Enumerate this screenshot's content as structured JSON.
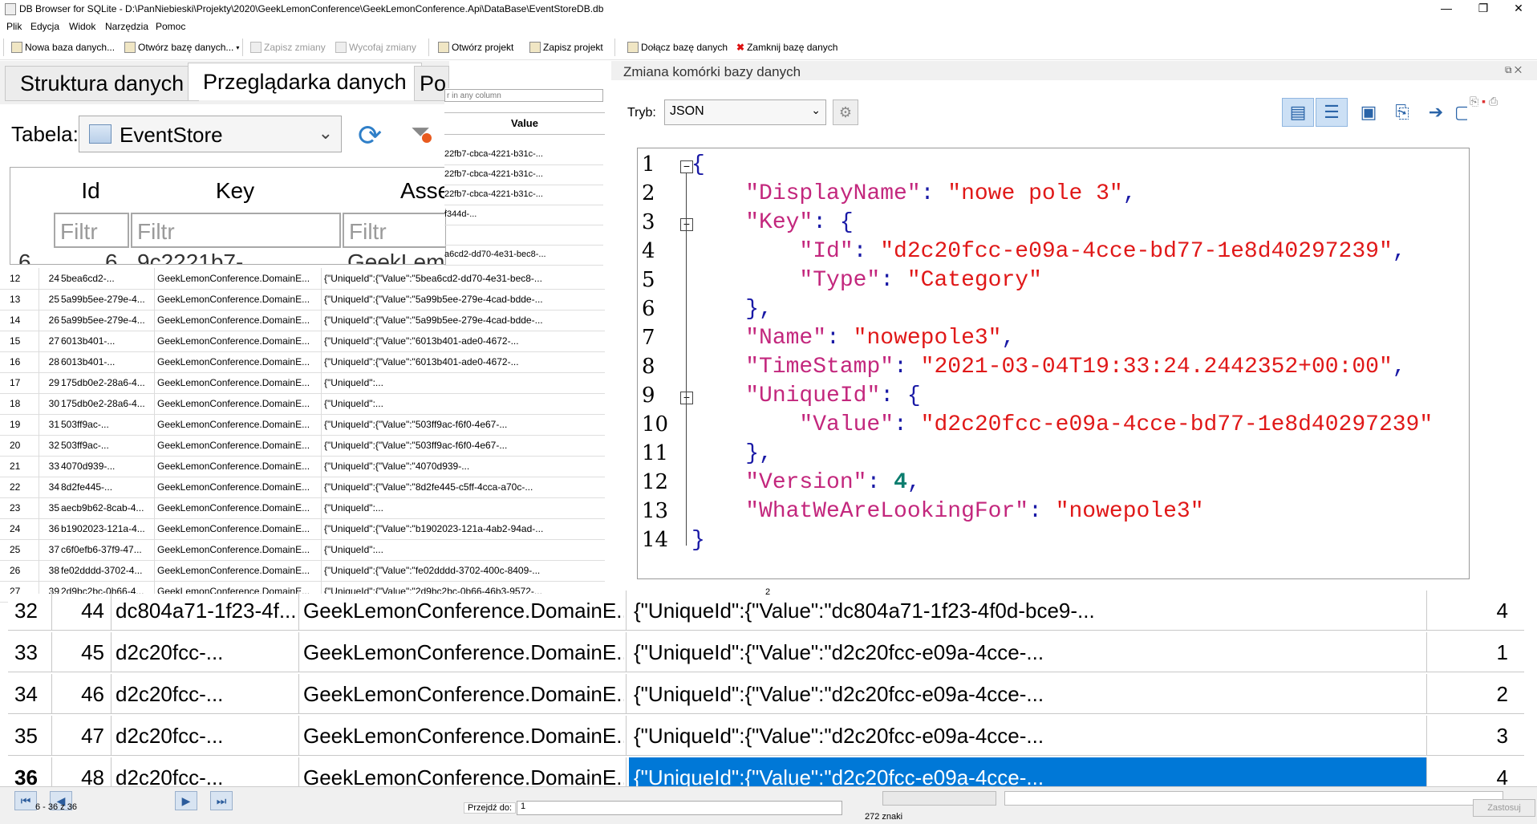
{
  "window": {
    "title": "DB Browser for SQLite - D:\\PanNiebieski\\Projekty\\2020\\GeekLemonConference\\GeekLemonConference.Api\\DataBase\\EventStoreDB.db",
    "minimize": "—",
    "maximize": "❐",
    "close": "✕"
  },
  "menu": [
    "Plik",
    "Edycja",
    "Widok",
    "Narzędzia",
    "Pomoc"
  ],
  "toolbar": {
    "new_db": "Nowa baza danych...",
    "open_db": "Otwórz bazę danych...",
    "save_changes": "Zapisz zmiany",
    "revert_changes": "Wycofaj zmiany",
    "open_project": "Otwórz projekt",
    "save_project": "Zapisz projekt",
    "attach_db": "Dołącz bazę danych",
    "close_db": "Zamknij bazę danych"
  },
  "tabs": {
    "structure": "Struktura danych",
    "browser": "Przeglądarka danych",
    "partial": "Po"
  },
  "browser": {
    "table_label": "Tabela:",
    "table_value": "EventStore",
    "columns": [
      "Id",
      "Key",
      "Asse"
    ],
    "filter_placeholder": "Filtr",
    "partial_row": {
      "num": "6",
      "id": "6",
      "key": "9c2221b7-...",
      "asm": "GeekLemo"
    }
  },
  "value_panel": {
    "search_placeholder": "r in any column",
    "header": "Value",
    "rows": [
      "22fb7-cbca-4221-b31c-...",
      "22fb7-cbca-4221-b31c-...",
      "22fb7-cbca-4221-b31c-...",
      "f344d-...",
      "",
      "a6cd2-dd70-4e31-bec8-..."
    ]
  },
  "small_rows": [
    {
      "n": "12",
      "id": "24",
      "key": "5bea6cd2-...",
      "asm": "GeekLemonConference.DomainE...",
      "val": "{\"UniqueId\":{\"Value\":\"5bea6cd2-dd70-4e31-bec8-..."
    },
    {
      "n": "13",
      "id": "25",
      "key": "5a99b5ee-279e-4...",
      "asm": "GeekLemonConference.DomainE...",
      "val": "{\"UniqueId\":{\"Value\":\"5a99b5ee-279e-4cad-bdde-..."
    },
    {
      "n": "14",
      "id": "26",
      "key": "5a99b5ee-279e-4...",
      "asm": "GeekLemonConference.DomainE...",
      "val": "{\"UniqueId\":{\"Value\":\"5a99b5ee-279e-4cad-bdde-..."
    },
    {
      "n": "15",
      "id": "27",
      "key": "6013b401-...",
      "asm": "GeekLemonConference.DomainE...",
      "val": "{\"UniqueId\":{\"Value\":\"6013b401-ade0-4672-..."
    },
    {
      "n": "16",
      "id": "28",
      "key": "6013b401-...",
      "asm": "GeekLemonConference.DomainE...",
      "val": "{\"UniqueId\":{\"Value\":\"6013b401-ade0-4672-..."
    },
    {
      "n": "17",
      "id": "29",
      "key": "175db0e2-28a6-4...",
      "asm": "GeekLemonConference.DomainE...",
      "val": "{\"UniqueId\":..."
    },
    {
      "n": "18",
      "id": "30",
      "key": "175db0e2-28a6-4...",
      "asm": "GeekLemonConference.DomainE...",
      "val": "{\"UniqueId\":..."
    },
    {
      "n": "19",
      "id": "31",
      "key": "503ff9ac-...",
      "asm": "GeekLemonConference.DomainE...",
      "val": "{\"UniqueId\":{\"Value\":\"503ff9ac-f6f0-4e67-..."
    },
    {
      "n": "20",
      "id": "32",
      "key": "503ff9ac-...",
      "asm": "GeekLemonConference.DomainE...",
      "val": "{\"UniqueId\":{\"Value\":\"503ff9ac-f6f0-4e67-..."
    },
    {
      "n": "21",
      "id": "33",
      "key": "4070d939-...",
      "asm": "GeekLemonConference.DomainE...",
      "val": "{\"UniqueId\":{\"Value\":\"4070d939-..."
    },
    {
      "n": "22",
      "id": "34",
      "key": "8d2fe445-...",
      "asm": "GeekLemonConference.DomainE...",
      "val": "{\"UniqueId\":{\"Value\":\"8d2fe445-c5ff-4cca-a70c-..."
    },
    {
      "n": "23",
      "id": "35",
      "key": "aecb9b62-8cab-4...",
      "asm": "GeekLemonConference.DomainE...",
      "val": "{\"UniqueId\":..."
    },
    {
      "n": "24",
      "id": "36",
      "key": "b1902023-121a-4...",
      "asm": "GeekLemonConference.DomainE...",
      "val": "{\"UniqueId\":{\"Value\":\"b1902023-121a-4ab2-94ad-..."
    },
    {
      "n": "25",
      "id": "37",
      "key": "c6f0efb6-37f9-47...",
      "asm": "GeekLemonConference.DomainE...",
      "val": "{\"UniqueId\":..."
    },
    {
      "n": "26",
      "id": "38",
      "key": "fe02dddd-3702-4...",
      "asm": "GeekLemonConference.DomainE...",
      "val": "{\"UniqueId\":{\"Value\":\"fe02dddd-3702-400c-8409-..."
    },
    {
      "n": "27",
      "id": "39",
      "key": "2d9bc2bc-0b66-4...",
      "asm": "GeekLemonConference.DomainE...",
      "val": "{\"UniqueId\":{\"Value\":\"2d9bc2bc-0b66-46b3-9572-..."
    }
  ],
  "editor": {
    "title": "Zmiana komórki bazy danych",
    "mode_label": "Tryb:",
    "mode_value": "JSON",
    "line_numbers": [
      "1",
      "2",
      "3",
      "4",
      "5",
      "6",
      "7",
      "8",
      "9",
      "10",
      "11",
      "12",
      "13",
      "14"
    ],
    "json": {
      "display_name_key": "\"DisplayName\"",
      "display_name_val": "\"nowe pole 3\"",
      "key_key": "\"Key\"",
      "id_key": "\"Id\"",
      "id_val": "\"d2c20fcc-e09a-4cce-bd77-1e8d40297239\"",
      "type_key": "\"Type\"",
      "type_val": "\"Category\"",
      "name_key": "\"Name\"",
      "name_val": "\"nowepole3\"",
      "timestamp_key": "\"TimeStamp\"",
      "timestamp_val": "\"2021-03-04T19:33:24.2442352+00:00\"",
      "uniqueid_key": "\"UniqueId\"",
      "value_key": "\"Value\"",
      "value_val": "\"d2c20fcc-e09a-4cce-bd77-1e8d40297239\"",
      "version_key": "\"Version\"",
      "version_val": "4",
      "lookingfor_key": "\"WhatWeAreLookingFor\"",
      "lookingfor_val": "\"nowepole3\""
    }
  },
  "lower_rows": [
    {
      "n": "32",
      "id": "44",
      "key": "dc804a71-1f23-4f...",
      "asm": "GeekLemonConference.DomainE...",
      "val": "{\"UniqueId\":{\"Value\":\"dc804a71-1f23-4f0d-bce9-...",
      "ver": "4"
    },
    {
      "n": "33",
      "id": "45",
      "key": "d2c20fcc-...",
      "asm": "GeekLemonConference.DomainE...",
      "val": "{\"UniqueId\":{\"Value\":\"d2c20fcc-e09a-4cce-...",
      "ver": "1"
    },
    {
      "n": "34",
      "id": "46",
      "key": "d2c20fcc-...",
      "asm": "GeekLemonConference.DomainE...",
      "val": "{\"UniqueId\":{\"Value\":\"d2c20fcc-e09a-4cce-...",
      "ver": "2"
    },
    {
      "n": "35",
      "id": "47",
      "key": "d2c20fcc-...",
      "asm": "GeekLemonConference.DomainE...",
      "val": "{\"UniqueId\":{\"Value\":\"d2c20fcc-e09a-4cce-...",
      "ver": "3"
    },
    {
      "n": "36",
      "id": "48",
      "key": "d2c20fcc-...",
      "asm": "GeekLemonConference.DomainE...",
      "val": "{\"UniqueId\":{\"Value\":\"d2c20fcc-e09a-4cce-...",
      "ver": "4",
      "selected": true
    }
  ],
  "status": {
    "record_range": "6 - 36 z 36",
    "goto_label": "Przejdź do:",
    "goto_value": "1",
    "char_count": "272 znaki",
    "apply": "Zastosuj",
    "small_num": "2"
  }
}
